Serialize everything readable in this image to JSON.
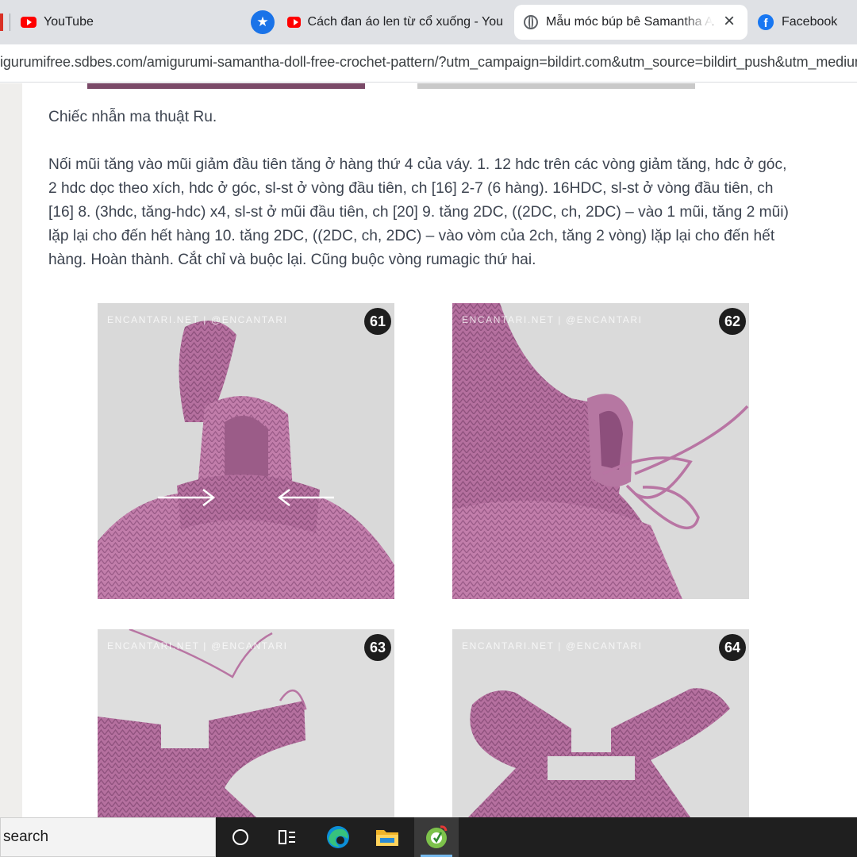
{
  "browser": {
    "bookmarks": [
      {
        "label": "YouTube",
        "icon": "youtube-icon"
      },
      {
        "label": "Cách đan áo len từ cổ xuống - You",
        "icon": "youtube-icon"
      },
      {
        "label": "Facebook",
        "icon": "facebook-icon"
      }
    ],
    "active_tab": {
      "label": "Mẫu móc búp bê Samantha A",
      "icon": "globe-icon"
    },
    "star_icon": "star-icon",
    "close_icon": "close-icon",
    "url": "igurumifree.sdbes.com/amigurumi-samantha-doll-free-crochet-pattern/?utm_campaign=bildirt.com&utm_source=bildirt_push&utm_medium"
  },
  "article": {
    "paragraphs": [
      "Chiếc nhẫn ma thuật Ru.",
      "Nối mũi tăng vào mũi giảm đầu tiên tăng ở hàng thứ 4 của váy. 1. 12 hdc trên các vòng giảm tăng, hdc ở góc, 2 hdc dọc theo xích, hdc ở góc, sl-st ở vòng đầu tiên, ch [16] 2-7 (6 hàng). 16HDC, sl-st ở vòng đầu tiên, ch [16] 8.  (3hdc, tăng-hdc) x4, sl-st ở mũi đầu tiên, ch [20] 9.  tăng 2DC, ((2DC, ch, 2DC) – vào 1 mũi, tăng 2 mũi) lặp lại cho đến hết hàng 10.      tăng 2DC, ((2DC, ch, 2DC) – vào vòm của 2ch, tăng 2 vòng) lặp lại cho đến hết hàng. Hoàn thành. Cắt chỉ và buộc lại. Cũng buộc vòng rumagic thứ hai."
    ],
    "photos": [
      {
        "number": "61",
        "watermark": "ENCANTARI.NET | @ENCANTARI"
      },
      {
        "number": "62",
        "watermark": "ENCANTARI.NET | @ENCANTARI"
      },
      {
        "number": "63",
        "watermark": "ENCANTARI.NET | @ENCANTARI"
      },
      {
        "number": "64",
        "watermark": "ENCANTARI.NET | @ENCANTARI"
      }
    ]
  },
  "taskbar": {
    "search_text": "search",
    "icons": [
      "start-circle-icon",
      "task-view-icon",
      "edge-icon",
      "file-explorer-icon",
      "coccoc-browser-icon"
    ]
  },
  "colors": {
    "yarn": "#b5709f",
    "yarn_dark": "#8a4a78",
    "photo_bg": "#dcdcdc",
    "text": "#3d4450",
    "taskbar": "#1f1f1f"
  }
}
